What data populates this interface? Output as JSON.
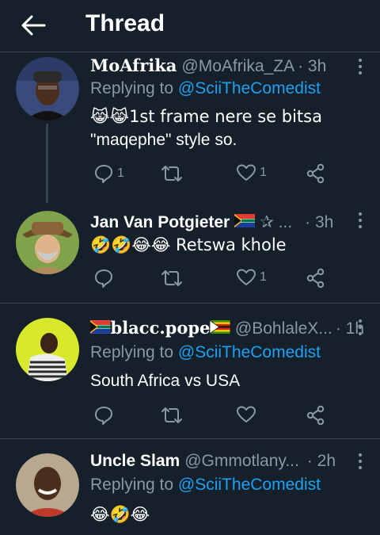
{
  "header": {
    "title": "Thread"
  },
  "tweets": [
    {
      "name": "MoAfrika",
      "handle": "@MoAfrika_ZA",
      "time": "· 3h",
      "replying_prefix": "Replying to ",
      "replying_to": "@SciiTheComedist",
      "text_line1": "😹😹1st frame nere se bitsa",
      "text_line2": "\"maqephe\" style so.",
      "reply_count": "1",
      "retweet_count": "",
      "like_count": "1"
    },
    {
      "name": "Jan Van Potgieter",
      "name_suffix": "✰ ...",
      "time": "· 3h",
      "text_line1": "🤣🤣😂😂 Retswa khole",
      "reply_count": "",
      "retweet_count": "",
      "like_count": "1"
    },
    {
      "name": "blacc.pope",
      "handle": "@BohlaleX...",
      "time": "· 1h",
      "replying_prefix": "Replying to ",
      "replying_to": "@SciiTheComedist",
      "text_line1": "South Africa vs USA",
      "reply_count": "",
      "retweet_count": "",
      "like_count": ""
    },
    {
      "name": "Uncle Slam",
      "handle": "@Gmmotlany...",
      "time": "· 2h",
      "replying_prefix": "Replying to ",
      "replying_to": "@SciiTheComedist",
      "text_line1": "😂🤣😂"
    }
  ],
  "icons": [
    "back-arrow-icon",
    "more-icon",
    "reply-icon",
    "retweet-icon",
    "like-icon",
    "share-icon"
  ],
  "colors": {
    "background": "#15202b",
    "secondary_text": "#8899a6",
    "link": "#1da1f2",
    "divider": "#38444d"
  }
}
